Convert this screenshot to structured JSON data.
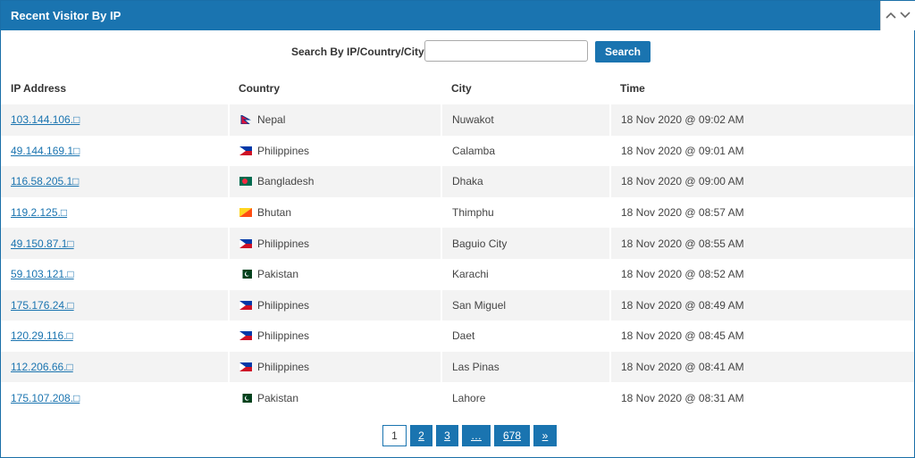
{
  "panel": {
    "title": "Recent Visitor By IP"
  },
  "search": {
    "label": "Search By IP/Country/City",
    "placeholder": "",
    "button": "Search"
  },
  "table": {
    "headers": [
      "IP Address",
      "Country",
      "City",
      "Time"
    ],
    "rows": [
      {
        "ip": "103.144.106.□",
        "country": "Nepal",
        "flag": "nepal-flag-icon",
        "city": "Nuwakot",
        "time": "18 Nov 2020 @ 09:02 AM"
      },
      {
        "ip": "49.144.169.1□",
        "country": "Philippines",
        "flag": "philippines-flag-icon",
        "city": "Calamba",
        "time": "18 Nov 2020 @ 09:01 AM"
      },
      {
        "ip": "116.58.205.1□",
        "country": "Bangladesh",
        "flag": "bangladesh-flag-icon",
        "city": "Dhaka",
        "time": "18 Nov 2020 @ 09:00 AM"
      },
      {
        "ip": "119.2.125.□",
        "country": "Bhutan",
        "flag": "bhutan-flag-icon",
        "city": "Thimphu",
        "time": "18 Nov 2020 @ 08:57 AM"
      },
      {
        "ip": "49.150.87.1□",
        "country": "Philippines",
        "flag": "philippines-flag-icon",
        "city": "Baguio City",
        "time": "18 Nov 2020 @ 08:55 AM"
      },
      {
        "ip": "59.103.121.□",
        "country": "Pakistan",
        "flag": "pakistan-flag-icon",
        "city": "Karachi",
        "time": "18 Nov 2020 @ 08:52 AM"
      },
      {
        "ip": "175.176.24.□",
        "country": "Philippines",
        "flag": "philippines-flag-icon",
        "city": "San Miguel",
        "time": "18 Nov 2020 @ 08:49 AM"
      },
      {
        "ip": "120.29.116.□",
        "country": "Philippines",
        "flag": "philippines-flag-icon",
        "city": "Daet",
        "time": "18 Nov 2020 @ 08:45 AM"
      },
      {
        "ip": "112.206.66.□",
        "country": "Philippines",
        "flag": "philippines-flag-icon",
        "city": "Las Pinas",
        "time": "18 Nov 2020 @ 08:41 AM"
      },
      {
        "ip": "175.107.208.□",
        "country": "Pakistan",
        "flag": "pakistan-flag-icon",
        "city": "Lahore",
        "time": "18 Nov 2020 @ 08:31 AM"
      }
    ]
  },
  "pagination": {
    "pages": [
      "1",
      "2",
      "3",
      "…",
      "678",
      "»"
    ],
    "current": "1"
  },
  "colors": {
    "accent": "#1a74b0",
    "row_stripe": "#f3f3f3"
  },
  "icons": {
    "collapse": "chevron-up-icon",
    "expand": "chevron-down-icon"
  }
}
